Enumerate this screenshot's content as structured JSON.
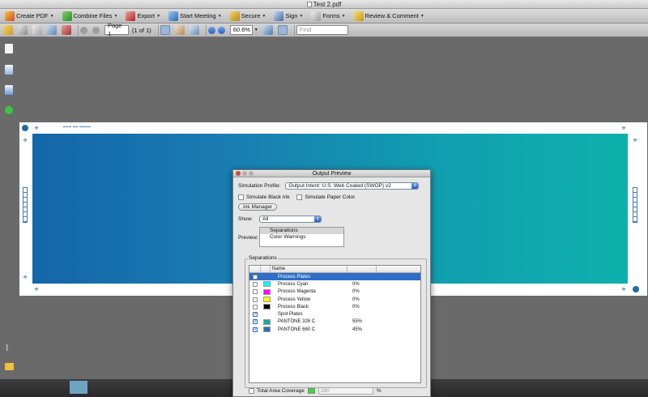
{
  "window": {
    "title": "Test 2.pdf"
  },
  "toolbar": {
    "create_pdf": "Create PDF",
    "combine_files": "Combine Files",
    "export": "Export",
    "start_meeting": "Start Meeting",
    "secure": "Secure",
    "sign": "Sign",
    "forms": "Forms",
    "review_comment": "Review & Comment"
  },
  "nav": {
    "page_value": "Page 1",
    "page_count": "(1 of 1)",
    "zoom_value": "60.6%",
    "find_placeholder": "Find"
  },
  "dialog": {
    "title": "Output Preview",
    "simulation_profile_label": "Simulation Profile:",
    "simulation_profile_value": "Output Intent: U.S. Web Coated (SWOP) v2",
    "simulate_black_ink": "Simulate Black Ink",
    "simulate_paper_color": "Simulate Paper Color",
    "ink_manager": "Ink Manager",
    "show_label": "Show:",
    "show_value": "All",
    "preview_label": "Preview:",
    "preview_options": [
      "Separations",
      "Color Warnings"
    ],
    "separations_label": "Separations",
    "table_header_name": "Name",
    "rows": [
      {
        "name": "Process Plates",
        "pct": "",
        "swatch": "",
        "checked": false,
        "selected": true
      },
      {
        "name": "Process Cyan",
        "pct": "0%",
        "swatch": "#00ffff",
        "checked": false,
        "selected": false
      },
      {
        "name": "Process Magenta",
        "pct": "0%",
        "swatch": "#ff00ff",
        "checked": false,
        "selected": false
      },
      {
        "name": "Process Yellow",
        "pct": "0%",
        "swatch": "#ffff00",
        "checked": false,
        "selected": false
      },
      {
        "name": "Process Black",
        "pct": "0%",
        "swatch": "#000000",
        "checked": false,
        "selected": false
      },
      {
        "name": "Spot Plates",
        "pct": "",
        "swatch": "",
        "checked": true,
        "selected": false
      },
      {
        "name": "PANTONE 326 C",
        "pct": "55%",
        "swatch": "#1aa8a8",
        "checked": true,
        "selected": false
      },
      {
        "name": "PANTONE 660 C",
        "pct": "45%",
        "swatch": "#2e6eb8",
        "checked": true,
        "selected": false
      }
    ],
    "total_area_coverage": "Total Area Coverage",
    "tac_value": "280",
    "tac_unit": "%"
  }
}
